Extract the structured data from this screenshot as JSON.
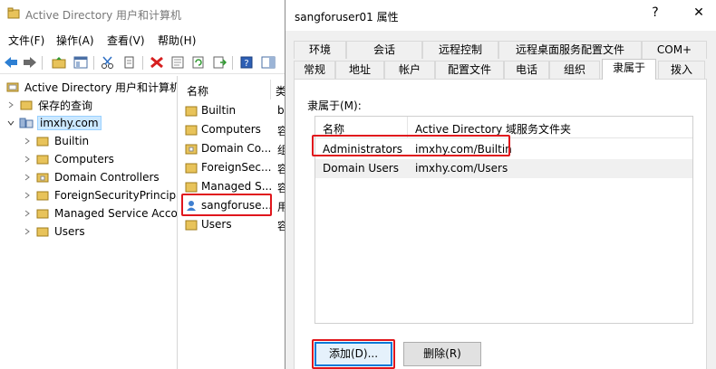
{
  "main_window": {
    "title": "Active Directory 用户和计算机",
    "menu": [
      "文件(F)",
      "操作(A)",
      "查看(V)",
      "帮助(H)"
    ],
    "tree": {
      "root": "Active Directory 用户和计算机",
      "saved_queries": "保存的查询",
      "domain": "imxhy.com",
      "children": [
        "Builtin",
        "Computers",
        "Domain Controllers",
        "ForeignSecurityPrincipals",
        "Managed Service Accounts",
        "Users"
      ]
    },
    "list": {
      "col_name": "名称",
      "col_type": "类",
      "rows": [
        {
          "name": "Builtin",
          "type": "b"
        },
        {
          "name": "Computers",
          "type": "容"
        },
        {
          "name": "Domain Co...",
          "type": "组"
        },
        {
          "name": "ForeignSec...",
          "type": "容"
        },
        {
          "name": "Managed S...",
          "type": "容"
        },
        {
          "name": "sangforuse...",
          "type": "用"
        },
        {
          "name": "Users",
          "type": "容"
        }
      ]
    }
  },
  "dialog": {
    "title": "sangforuser01 属性",
    "help": "?",
    "close": "✕",
    "tabs_row1": [
      "环境",
      "会话",
      "远程控制",
      "远程桌面服务配置文件",
      "COM+"
    ],
    "tabs_row2": [
      "常规",
      "地址",
      "帐户",
      "配置文件",
      "电话",
      "组织",
      "隶属于",
      "拨入"
    ],
    "active_tab": "隶属于",
    "member_of_label": "隶属于(M):",
    "columns": [
      "名称",
      "Active Directory 域服务文件夹"
    ],
    "rows": [
      {
        "name": "Administrators",
        "folder": "imxhy.com/Builtin"
      },
      {
        "name": "Domain Users",
        "folder": "imxhy.com/Users"
      }
    ],
    "add_button": "添加(D)...",
    "remove_button": "删除(R)"
  },
  "colors": {
    "highlight_red": "#e0161c",
    "selection_blue": "#cce8ff",
    "default_button_border": "#0078d7"
  }
}
